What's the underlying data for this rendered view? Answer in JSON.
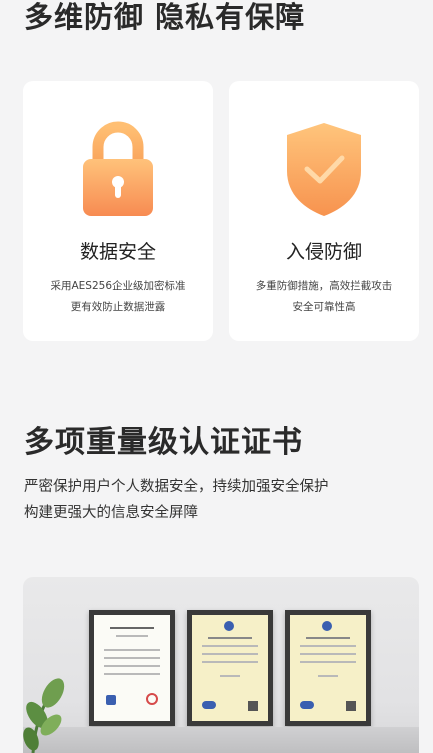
{
  "section1": {
    "title": "多维防御 隐私有保障",
    "cards": [
      {
        "icon": "lock-icon",
        "title": "数据安全",
        "lines": [
          "采用AES256企业级加密标准",
          "更有效防止数据泄露"
        ]
      },
      {
        "icon": "shield-check-icon",
        "title": "入侵防御",
        "lines": [
          "多重防御措施，高效拦截攻击",
          "安全可靠性高"
        ]
      }
    ]
  },
  "section2": {
    "title": "多项重量级认证证书",
    "lines": [
      "严密保护用户个人数据安全，持续加强安全保护",
      "构建更强大的信息安全屏障"
    ]
  },
  "colors": {
    "accent_orange": "#f7a24a",
    "background": "#f4f4f5"
  }
}
